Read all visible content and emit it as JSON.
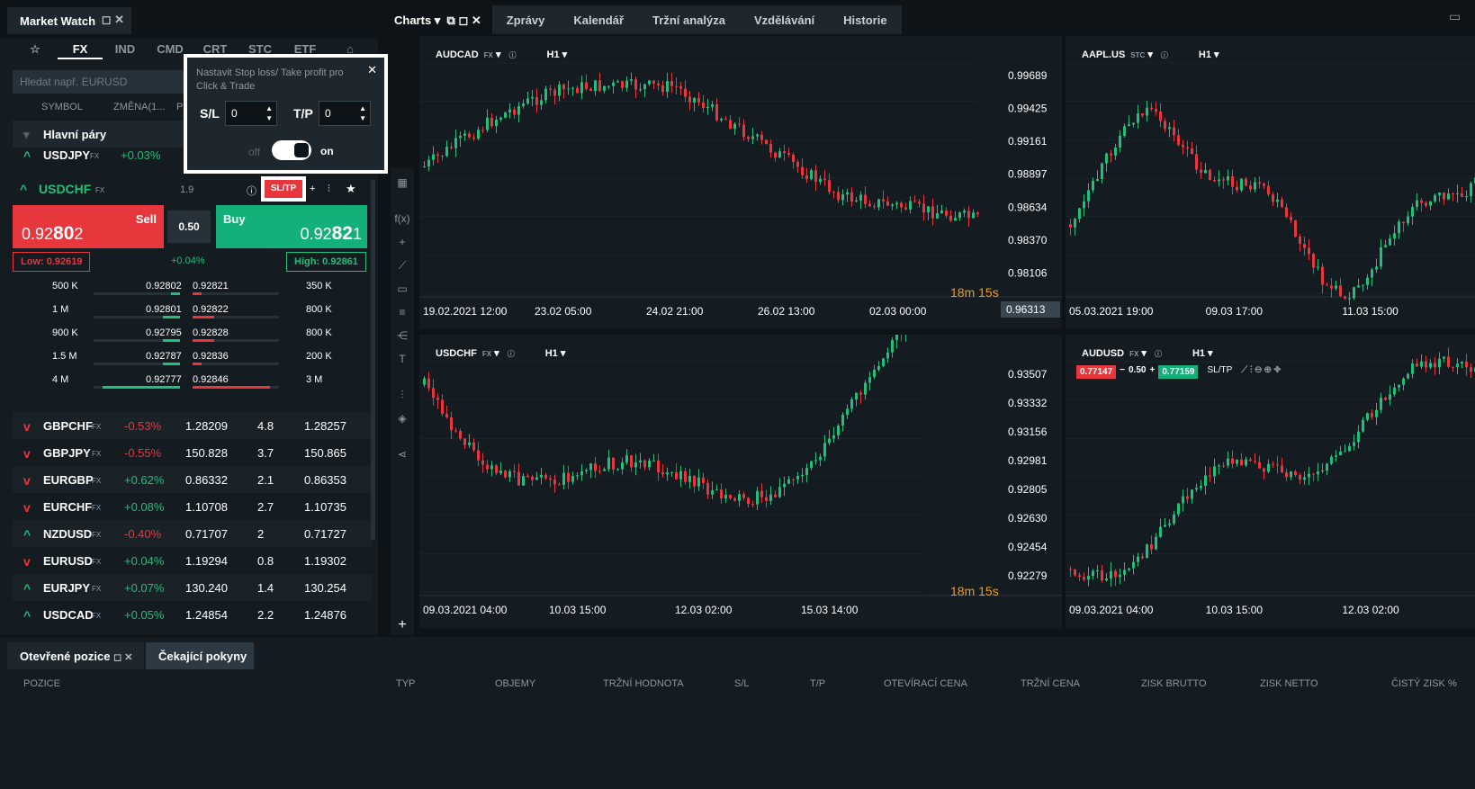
{
  "market_watch": {
    "title": "Market Watch",
    "categories": [
      "☆",
      "FX",
      "IND",
      "CMD",
      "CRT",
      "STC",
      "ETF"
    ],
    "search_placeholder": "Hledat např. EURUSD",
    "col_symbol": "SYMBOL",
    "col_change": "ZMĚNA(1...",
    "col_extra": "P",
    "group": "Hlavní páry",
    "usdjpy": {
      "symbol": "USDJPY",
      "type": "FX",
      "change": "+0.03%"
    },
    "selected": {
      "symbol": "USDCHF",
      "type": "FX",
      "spread": "1.9",
      "sltp": "SL/TP",
      "sell_label": "Sell",
      "sell_pre": "0.92",
      "sell_big": "80",
      "sell_post": "2",
      "lot": "0.50",
      "buy_label": "Buy",
      "buy_pre": "0.92",
      "buy_big": "82",
      "buy_post": "1",
      "low": "Low: 0.92619",
      "high": "High: 0.92861",
      "change": "+0.04%"
    },
    "depth": [
      {
        "lvol": "500 K",
        "bid": "0.92802",
        "ask": "0.92821",
        "rvol": "350 K",
        "bw": 0.1,
        "aw": 0.1
      },
      {
        "lvol": "1 M",
        "bid": "0.92801",
        "ask": "0.92822",
        "rvol": "800 K",
        "bw": 0.2,
        "aw": 0.25
      },
      {
        "lvol": "900 K",
        "bid": "0.92795",
        "ask": "0.92828",
        "rvol": "800 K",
        "bw": 0.2,
        "aw": 0.25
      },
      {
        "lvol": "1.5 M",
        "bid": "0.92787",
        "ask": "0.92836",
        "rvol": "200 K",
        "bw": 0.2,
        "aw": 0.1
      },
      {
        "lvol": "4 M",
        "bid": "0.92777",
        "ask": "0.92846",
        "rvol": "3 M",
        "bw": 0.9,
        "aw": 0.9
      }
    ],
    "rows": [
      {
        "symbol": "GBPCHF",
        "dir": "down",
        "change": "-0.53%",
        "bid": "1.28209",
        "spread": "4.8",
        "ask": "1.28257"
      },
      {
        "symbol": "GBPJPY",
        "dir": "down",
        "change": "-0.55%",
        "bid": "150.828",
        "spread": "3.7",
        "ask": "150.865"
      },
      {
        "symbol": "EURGBP",
        "dir": "down",
        "change": "+0.62%",
        "bid": "0.86332",
        "spread": "2.1",
        "ask": "0.86353"
      },
      {
        "symbol": "EURCHF",
        "dir": "down",
        "change": "+0.08%",
        "bid": "1.10708",
        "spread": "2.7",
        "ask": "1.10735"
      },
      {
        "symbol": "NZDUSD",
        "dir": "up",
        "change": "-0.40%",
        "bid": "0.71707",
        "spread": "2",
        "ask": "0.71727"
      },
      {
        "symbol": "EURUSD",
        "dir": "down",
        "change": "+0.04%",
        "bid": "1.19294",
        "spread": "0.8",
        "ask": "1.19302"
      },
      {
        "symbol": "EURJPY",
        "dir": "up",
        "change": "+0.07%",
        "bid": "130.240",
        "spread": "1.4",
        "ask": "130.254"
      },
      {
        "symbol": "USDCAD",
        "dir": "up",
        "change": "+0.05%",
        "bid": "1.24854",
        "spread": "2.2",
        "ask": "1.24876"
      }
    ]
  },
  "popup": {
    "text": "Nastavit Stop loss/ Take profit pro Click & Trade",
    "sl_label": "S/L",
    "sl_value": "0",
    "tp_label": "T/P",
    "tp_value": "0",
    "off": "off",
    "on": "on"
  },
  "nav": {
    "charts": "Charts",
    "tabs": [
      "Zprávy",
      "Kalendář",
      "Tržní analýza",
      "Vzdělávání",
      "Historie"
    ]
  },
  "charts": [
    {
      "symbol": "AUDCAD",
      "type": "FX",
      "tf": "H1",
      "y": [
        "0.99689",
        "0.99425",
        "0.99161",
        "0.98897",
        "0.98634",
        "0.98370",
        "0.98106"
      ],
      "last": "0.96313",
      "x": [
        "19.02.2021 12:00",
        "23.02 05:00",
        "24.02 21:00",
        "26.02 13:00",
        "02.03 00:00"
      ],
      "timer_m": "18m",
      "timer_s": "15s"
    },
    {
      "symbol": "AAPL.US",
      "type": "STC",
      "tf": "H1",
      "x": [
        "05.03.2021 19:00",
        "09.03 17:00",
        "11.03 15:00"
      ]
    },
    {
      "symbol": "USDCHF",
      "type": "FX",
      "tf": "H1",
      "y": [
        "0.93507",
        "0.93332",
        "0.93156",
        "0.92981",
        "0.92805",
        "0.92630",
        "0.92454",
        "0.92279"
      ],
      "x": [
        "09.03.2021 04:00",
        "10.03 15:00",
        "12.03 02:00",
        "15.03 14:00"
      ],
      "timer_m": "18m",
      "timer_s": "15s"
    },
    {
      "symbol": "AUDUSD",
      "type": "FX",
      "tf": "H1",
      "sell": "0.77147",
      "lot": "0.50",
      "buy": "0.77159",
      "sltp": "SL/TP",
      "x": [
        "09.03.2021 04:00",
        "10.03 15:00",
        "12.03 02:00"
      ]
    }
  ],
  "bottom": {
    "tab1": "Otevřené pozice",
    "tab2": "Čekající pokyny",
    "cols": [
      "POZICE",
      "TYP",
      "OBJEMY",
      "TRŽNÍ HODNOTA",
      "S/L",
      "T/P",
      "OTEVÍRACÍ CENA",
      "TRŽNÍ CENA",
      "ZISK BRUTTO",
      "ZISK NETTO",
      "ČISTÝ ZISK %"
    ]
  },
  "colors": {
    "bull": "#1fbf7c",
    "bear": "#e8363d",
    "accent": "#f39c12"
  }
}
